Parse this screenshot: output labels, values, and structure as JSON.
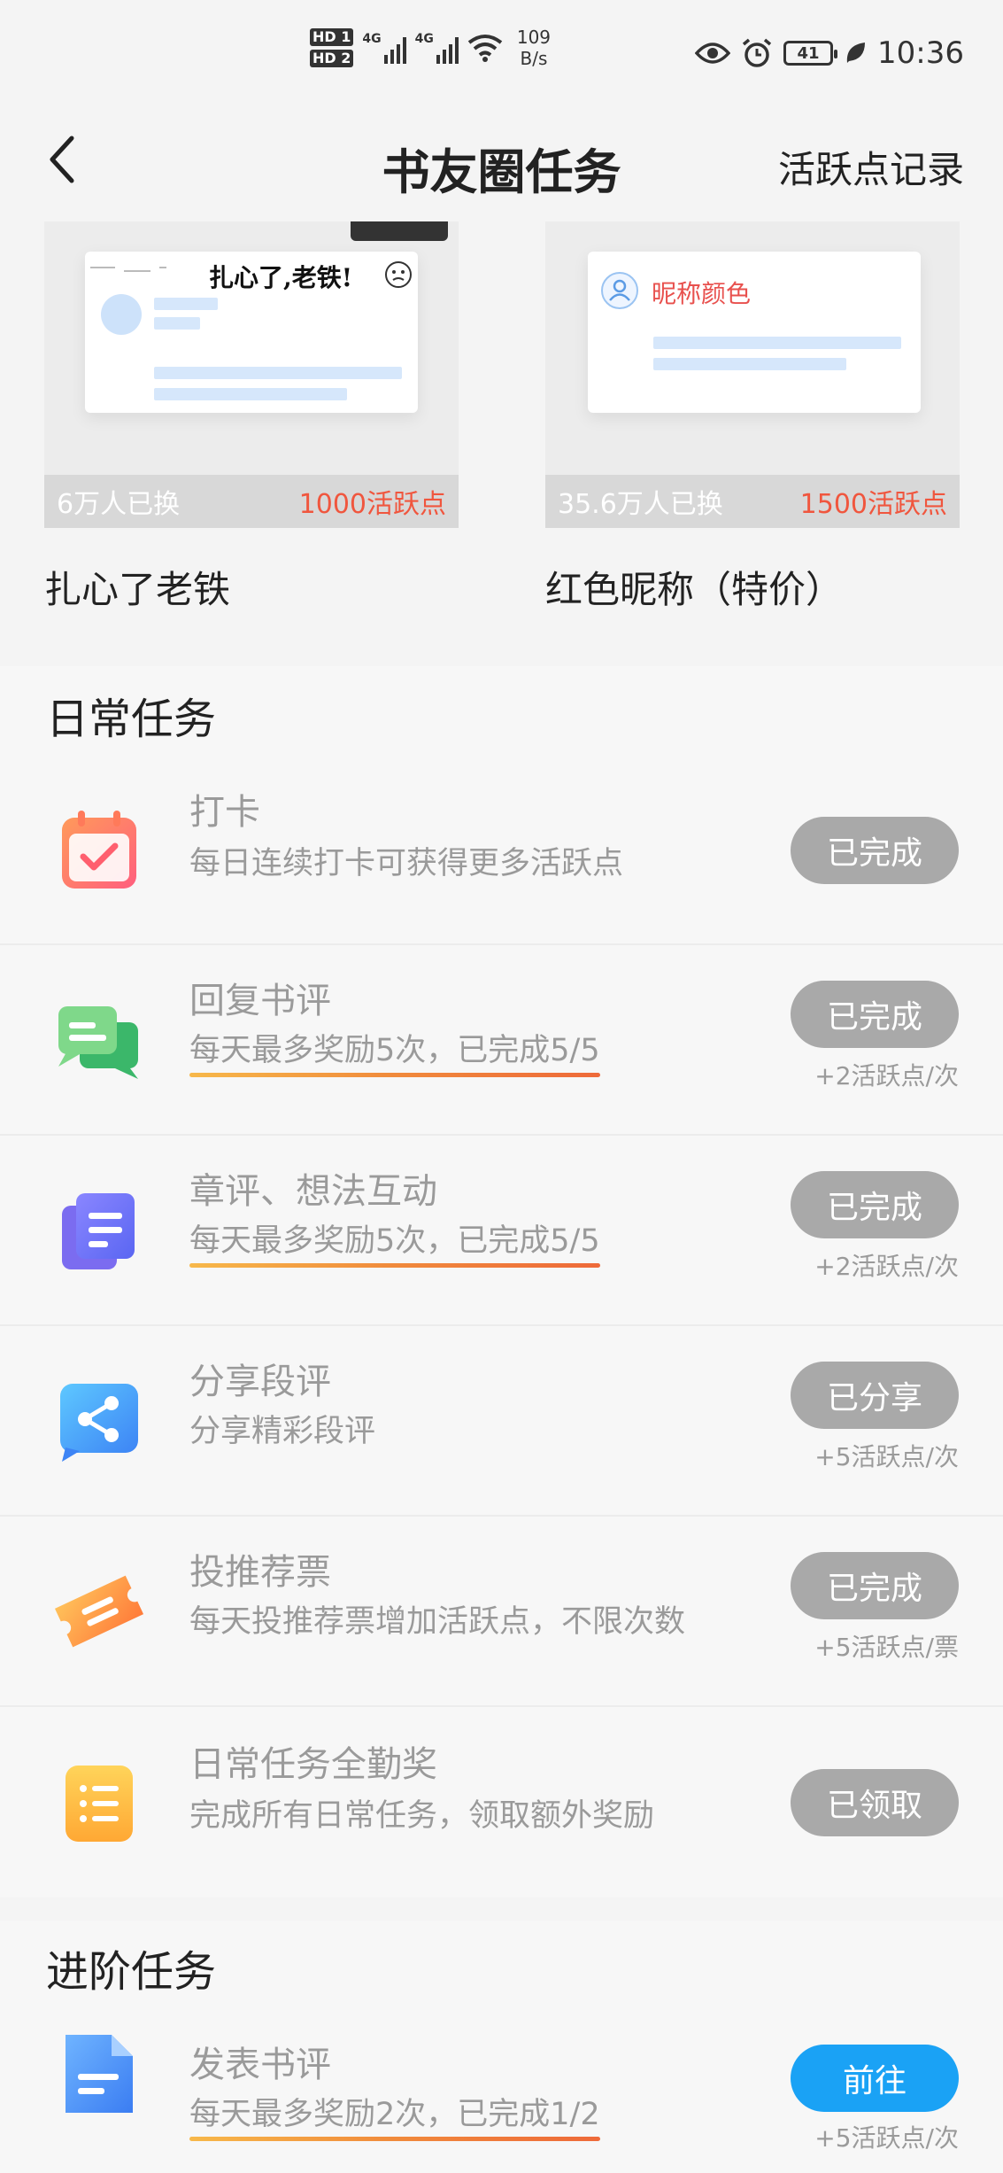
{
  "status_bar": {
    "hd1": "HD 1",
    "hd2": "HD 2",
    "net1": "4G",
    "net2": "4G",
    "speed_value": "109",
    "speed_unit": "B/s",
    "battery": "41",
    "time": "10:36"
  },
  "nav": {
    "title": "书友圈任务",
    "right_link": "活跃点记录"
  },
  "rewards": [
    {
      "banner_text": "扎心了,老铁!",
      "exchanged": "6万人已换",
      "points": "1000活跃点",
      "name": "扎心了老铁"
    },
    {
      "banner_text": "昵称颜色",
      "exchanged": "35.6万人已换",
      "points": "1500活跃点",
      "name": "红色昵称（特价）"
    }
  ],
  "daily": {
    "title": "日常任务",
    "tasks": [
      {
        "name": "打卡",
        "desc": "每日连续打卡可获得更多活跃点",
        "button": "已完成",
        "reward": "",
        "icon": "calendar-icon"
      },
      {
        "name": "回复书评",
        "desc": "每天最多奖励5次，已完成5/5",
        "button": "已完成",
        "reward": "+2活跃点/次",
        "icon": "chat-bubbles-icon"
      },
      {
        "name": "章评、想法互动",
        "desc": "每天最多奖励5次，已完成5/5",
        "button": "已完成",
        "reward": "+2活跃点/次",
        "icon": "documents-icon"
      },
      {
        "name": "分享段评",
        "desc": "分享精彩段评",
        "button": "已分享",
        "reward": "+5活跃点/次",
        "icon": "share-icon"
      },
      {
        "name": "投推荐票",
        "desc": "每天投推荐票增加活跃点，不限次数",
        "button": "已完成",
        "reward": "+5活跃点/票",
        "icon": "ticket-icon"
      },
      {
        "name": "日常任务全勤奖",
        "desc": "完成所有日常任务，领取额外奖励",
        "button": "已领取",
        "reward": "",
        "icon": "checklist-icon"
      }
    ]
  },
  "advanced": {
    "title": "进阶任务",
    "tasks": [
      {
        "name": "发表书评",
        "desc": "每天最多奖励2次，已完成1/2",
        "button": "前往",
        "reward": "+5活跃点/次",
        "icon": "document-icon"
      }
    ]
  },
  "colors": {
    "points_red": "#f0563e",
    "button_gray": "#a9a9a9",
    "button_blue": "#1aa2f5"
  }
}
